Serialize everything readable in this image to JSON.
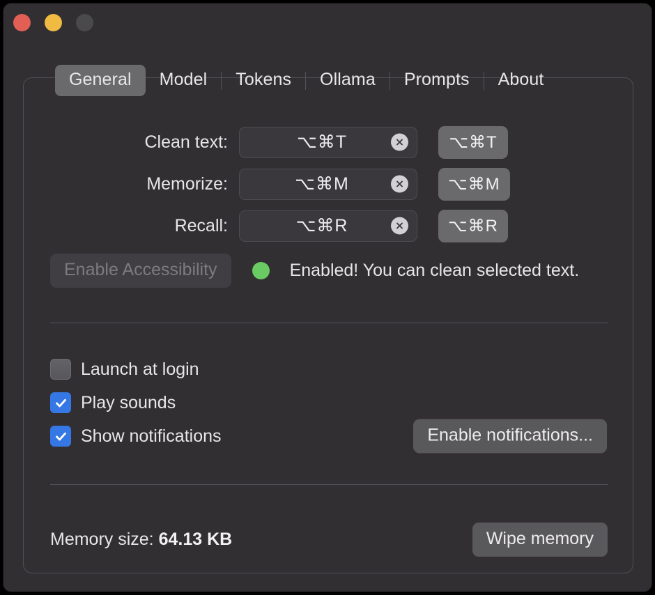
{
  "window": {
    "traffic_lights": [
      {
        "name": "close",
        "color": "#E15F54"
      },
      {
        "name": "minimize",
        "color": "#F0BB42"
      },
      {
        "name": "zoom",
        "color": "#4A4A4C"
      }
    ]
  },
  "tabs": [
    {
      "label": "General",
      "active": true
    },
    {
      "label": "Model",
      "active": false
    },
    {
      "label": "Tokens",
      "active": false
    },
    {
      "label": "Ollama",
      "active": false
    },
    {
      "label": "Prompts",
      "active": false
    },
    {
      "label": "About",
      "active": false
    }
  ],
  "shortcuts": [
    {
      "label": "Clean text:",
      "value": "⌥⌘T",
      "clear_icon": "clear-circle-icon",
      "key_button": "⌥⌘T"
    },
    {
      "label": "Memorize:",
      "value": "⌥⌘M",
      "clear_icon": "clear-circle-icon",
      "key_button": "⌥⌘M"
    },
    {
      "label": "Recall:",
      "value": "⌥⌘R",
      "clear_icon": "clear-circle-icon",
      "key_button": "⌥⌘R"
    }
  ],
  "accessibility": {
    "button_label": "Enable Accessibility",
    "button_disabled": true,
    "status_color": "#6ACB62",
    "status_text": "Enabled! You can clean selected text."
  },
  "checkboxes": [
    {
      "label": "Launch at login",
      "checked": false
    },
    {
      "label": "Play sounds",
      "checked": true
    },
    {
      "label": "Show notifications",
      "checked": true
    }
  ],
  "notifications": {
    "button_label": "Enable notifications..."
  },
  "memory": {
    "label": "Memory size:",
    "value": "64.13 KB",
    "wipe_label": "Wipe memory"
  },
  "colors": {
    "window_bg": "#322F33",
    "accent_blue": "#3578E5",
    "status_green": "#6ACB62",
    "button_gray": "#59585B",
    "tab_active": "#6A6A6C"
  }
}
